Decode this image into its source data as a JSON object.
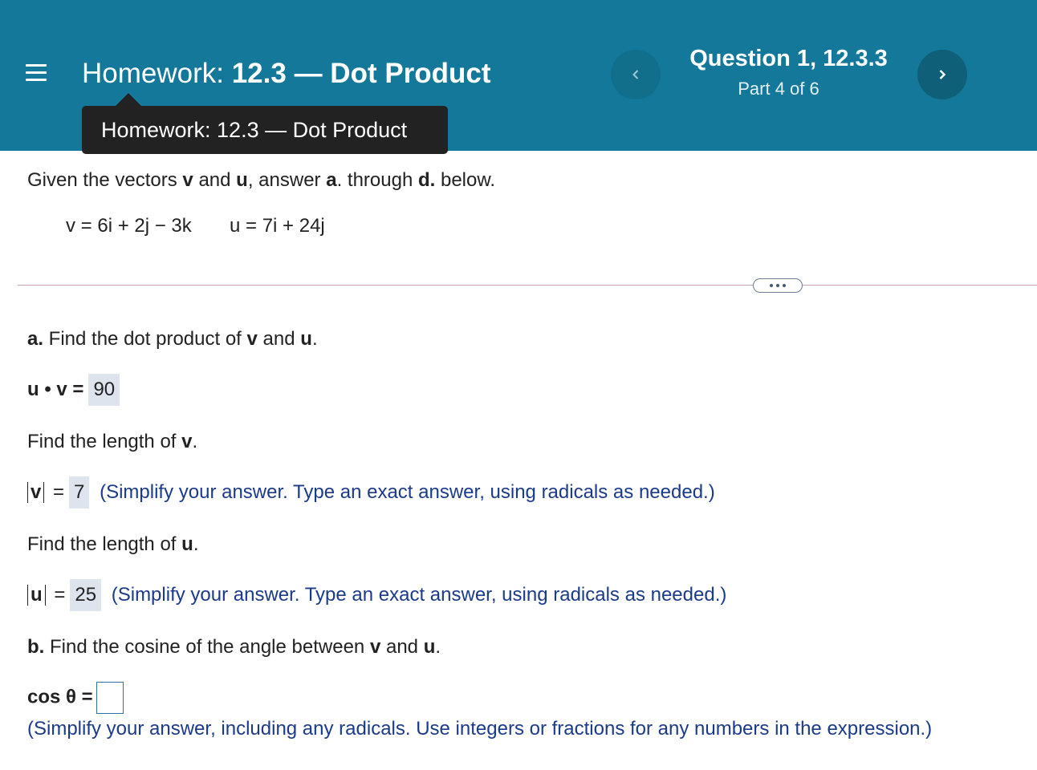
{
  "header": {
    "menu_icon": "hamburger-menu-icon",
    "hw_prefix": "Homework:",
    "hw_name": "12.3 — Dot Product",
    "tooltip": "Homework:  12.3 — Dot Product",
    "question_title": "Question 1, 12.3.3",
    "question_part": "Part 4 of 6",
    "prev_icon": "chevron-left-icon",
    "next_icon": "chevron-right-icon"
  },
  "problem": {
    "intro_1": "Given the vectors ",
    "intro_v": "v",
    "intro_2": " and ",
    "intro_u": "u",
    "intro_3": ", answer ",
    "intro_a": "a",
    "intro_4": ". through ",
    "intro_d": "d.",
    "intro_5": " below.",
    "vec_v": "v = 6i + 2j − 3k",
    "vec_u": "u = 7i + 24j"
  },
  "part_a": {
    "label": "a.",
    "text_1": " Find the dot product of ",
    "v": "v",
    "and": " and ",
    "u": "u",
    "dot": ".",
    "uv_label": "u • v =",
    "uv_answer": "90",
    "len_v_text": "Find the length of ",
    "len_v_var": "v",
    "len_v_dot": ".",
    "abs_v": "v",
    "eq": "=",
    "len_v_answer": "7",
    "len_u_text": "Find the length of ",
    "len_u_var": "u",
    "len_u_dot": ".",
    "abs_u": "u",
    "len_u_answer": "25",
    "hint": "(Simplify your answer. Type an exact answer, using radicals as needed.)"
  },
  "part_b": {
    "label": "b.",
    "text_1": " Find the cosine of the angle between ",
    "v": "v",
    "and": " and ",
    "u": "u",
    "dot": ".",
    "cos_label": "cos θ =",
    "hint": "(Simplify your answer, including any radicals. Use integers or fractions for any numbers in the expression.)"
  },
  "colors": {
    "header_bg": "#137899",
    "tooltip_bg": "#222222",
    "answer_bg": "#dde4ee",
    "hint_text": "#1a3a8a"
  }
}
